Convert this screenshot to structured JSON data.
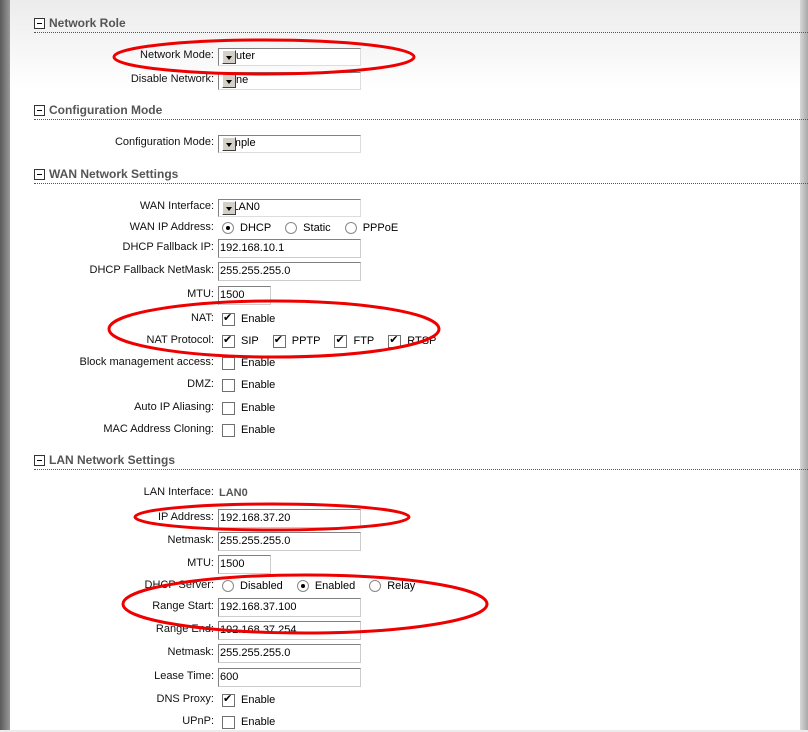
{
  "sections": [
    {
      "title": "Network Role",
      "rows": [
        {
          "label": "Network Mode:",
          "type": "select",
          "value": "Router"
        },
        {
          "label": "Disable Network:",
          "type": "select",
          "value": "None"
        }
      ]
    },
    {
      "title": "Configuration Mode",
      "rows": [
        {
          "label": "Configuration Mode:",
          "type": "select",
          "value": "Simple"
        }
      ]
    },
    {
      "title": "WAN Network Settings",
      "rows": [
        {
          "label": "WAN Interface:",
          "type": "select",
          "value": "WLAN0"
        },
        {
          "label": "WAN IP Address:",
          "type": "radio",
          "options": [
            {
              "label": "DHCP",
              "checked": true
            },
            {
              "label": "Static",
              "checked": false
            },
            {
              "label": "PPPoE",
              "checked": false
            }
          ]
        },
        {
          "label": "DHCP Fallback IP:",
          "type": "input",
          "value": "192.168.10.1"
        },
        {
          "label": "DHCP Fallback NetMask:",
          "type": "input",
          "value": "255.255.255.0"
        },
        {
          "label": "MTU:",
          "type": "input-short",
          "value": "1500"
        },
        {
          "label": "NAT:",
          "type": "checkbox",
          "options": [
            {
              "label": "Enable",
              "checked": true
            }
          ]
        },
        {
          "label": "NAT Protocol:",
          "type": "checkbox",
          "options": [
            {
              "label": "SIP",
              "checked": true
            },
            {
              "label": "PPTP",
              "checked": true
            },
            {
              "label": "FTP",
              "checked": true
            },
            {
              "label": "RTSP",
              "checked": true
            }
          ]
        },
        {
          "label": "Block management access:",
          "type": "checkbox",
          "options": [
            {
              "label": "Enable",
              "checked": false
            }
          ]
        },
        {
          "label": "DMZ:",
          "type": "checkbox",
          "options": [
            {
              "label": "Enable",
              "checked": false
            }
          ]
        },
        {
          "label": "Auto IP Aliasing:",
          "type": "checkbox",
          "options": [
            {
              "label": "Enable",
              "checked": false
            }
          ]
        },
        {
          "label": "MAC Address Cloning:",
          "type": "checkbox",
          "options": [
            {
              "label": "Enable",
              "checked": false
            }
          ]
        }
      ]
    },
    {
      "title": "LAN Network Settings",
      "rows": [
        {
          "label": "LAN Interface:",
          "type": "static",
          "value": "LAN0"
        },
        {
          "label": "IP Address:",
          "type": "input",
          "value": "192.168.37.20"
        },
        {
          "label": "Netmask:",
          "type": "input",
          "value": "255.255.255.0"
        },
        {
          "label": "MTU:",
          "type": "input-short",
          "value": "1500"
        },
        {
          "label": "DHCP Server:",
          "type": "radio",
          "options": [
            {
              "label": "Disabled",
              "checked": false
            },
            {
              "label": "Enabled",
              "checked": true
            },
            {
              "label": "Relay",
              "checked": false
            }
          ]
        },
        {
          "label": "Range Start:",
          "type": "input",
          "value": "192.168.37.100"
        },
        {
          "label": "Range End:",
          "type": "input",
          "value": "192.168.37.254"
        },
        {
          "label": "Netmask:",
          "type": "input",
          "value": "255.255.255.0"
        },
        {
          "label": "Lease Time:",
          "type": "input",
          "value": "600"
        },
        {
          "label": "DNS Proxy:",
          "type": "checkbox",
          "options": [
            {
              "label": "Enable",
              "checked": true
            }
          ]
        },
        {
          "label": "UPnP:",
          "type": "checkbox",
          "options": [
            {
              "label": "Enable",
              "checked": false
            }
          ]
        }
      ]
    }
  ],
  "annotation_color": "#ee0000"
}
